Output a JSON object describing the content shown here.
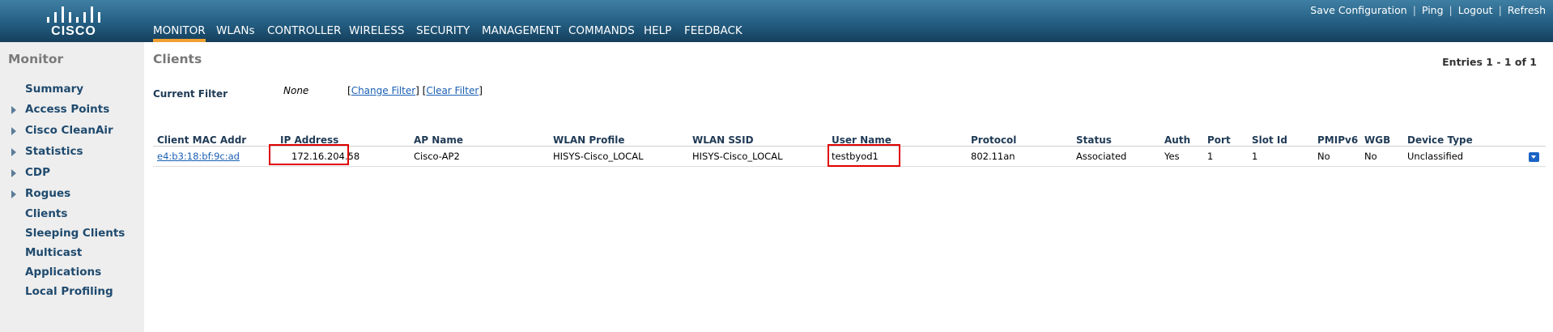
{
  "header": {
    "logo_text": "CISCO",
    "nav": [
      "MONITOR",
      "WLANs",
      "CONTROLLER",
      "WIRELESS",
      "SECURITY",
      "MANAGEMENT",
      "COMMANDS",
      "HELP",
      "FEEDBACK"
    ],
    "active_nav": "MONITOR",
    "top_links": [
      "Save Configuration",
      "Ping",
      "Logout",
      "Refresh"
    ]
  },
  "sidebar": {
    "title": "Monitor",
    "items": [
      {
        "label": "Summary",
        "expandable": false
      },
      {
        "label": "Access Points",
        "expandable": true
      },
      {
        "label": "Cisco CleanAir",
        "expandable": true
      },
      {
        "label": "Statistics",
        "expandable": true
      },
      {
        "label": "CDP",
        "expandable": true
      },
      {
        "label": "Rogues",
        "expandable": true
      },
      {
        "label": "Clients",
        "expandable": false
      },
      {
        "label": "Sleeping Clients",
        "expandable": false
      },
      {
        "label": "Multicast",
        "expandable": false
      },
      {
        "label": "Applications",
        "expandable": false
      },
      {
        "label": "Local Profiling",
        "expandable": false
      }
    ]
  },
  "main": {
    "title": "Clients",
    "entries": "Entries 1 - 1 of 1",
    "filter": {
      "label": "Current Filter",
      "value": "None",
      "change_label": "Change Filter",
      "clear_label": "Clear Filter"
    },
    "table": {
      "columns": [
        "Client MAC Addr",
        "IP Address",
        "AP Name",
        "WLAN Profile",
        "WLAN SSID",
        "User Name",
        "Protocol",
        "Status",
        "Auth",
        "Port",
        "Slot Id",
        "PMIPv6",
        "WGB",
        "Device Type"
      ],
      "rows": [
        [
          "e4:b3:18:bf:9c:ad",
          "172.16.204.58",
          "Cisco-AP2",
          "HISYS-Cisco_LOCAL",
          "HISYS-Cisco_LOCAL",
          "testbyod1",
          "802.11an",
          "Associated",
          "Yes",
          "1",
          "1",
          "No",
          "No",
          "Unclassified"
        ]
      ]
    }
  },
  "colors": {
    "header_gradient_top": "#3f7fa4",
    "header_gradient_bottom": "#153f5c",
    "active_tab_underline": "#f0a030",
    "sidebar_bg": "#eeeeee",
    "highlight_box": "#e00000",
    "link": "#1a5fb4"
  }
}
